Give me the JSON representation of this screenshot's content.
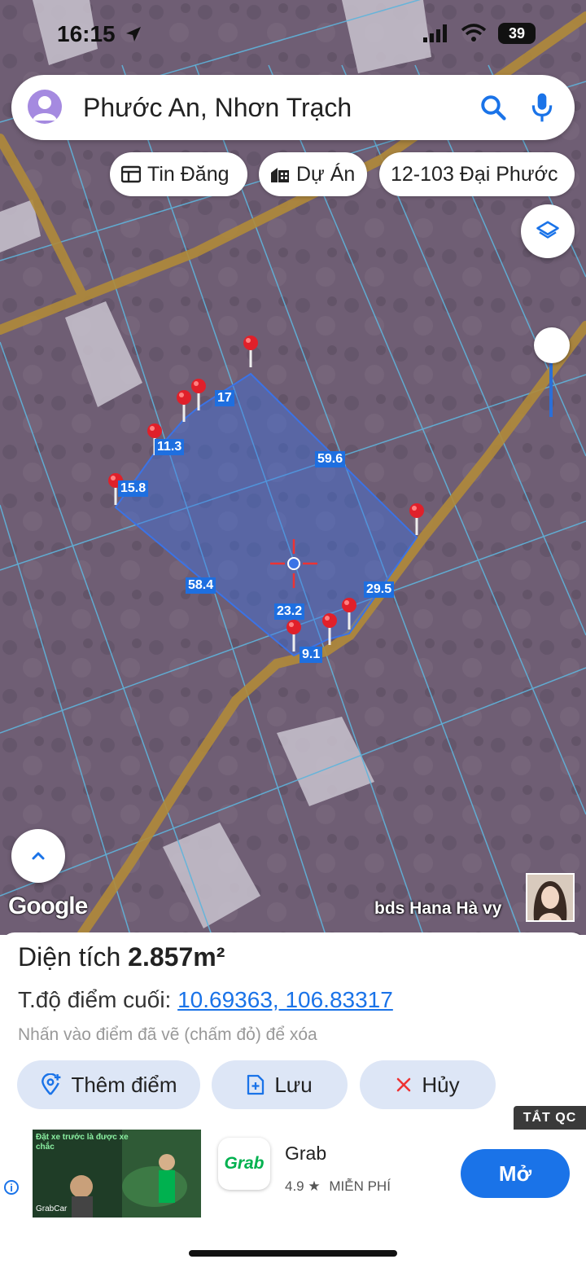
{
  "status_bar": {
    "time": "16:15",
    "battery": "39"
  },
  "search": {
    "query": "Phước An, Nhơn Trạch"
  },
  "chips": [
    {
      "label": "Tin Đăng",
      "icon": "newspaper-icon"
    },
    {
      "label": "Dự Án",
      "icon": "building-icon"
    },
    {
      "label": "12-103 Đại Phước"
    }
  ],
  "map": {
    "segment_labels": [
      "17",
      "11.3",
      "15.8",
      "59.6",
      "58.4",
      "29.5",
      "23.2",
      "9.1"
    ],
    "google_logo": "Google",
    "watermark": "bds Hana Hà vy"
  },
  "sheet": {
    "area_label": "Diện tích",
    "area_value": "2.857m²",
    "coord_label": "T.độ điểm cuối:",
    "coord_value": "10.69363, 106.83317",
    "hint": "Nhấn vào điểm đã vẽ (chấm đỏ) để xóa"
  },
  "actions": {
    "add_point": "Thêm điểm",
    "save": "Lưu",
    "cancel": "Hủy"
  },
  "ad": {
    "close_label": "TẮT QC",
    "app_logo": "Grab",
    "app_name": "Grab",
    "rating": "4.9",
    "price": "MIỄN PHÍ",
    "open_label": "Mở",
    "banner_text": "Đặt xe trước là được xe chắc",
    "banner_brand": "GrabCar"
  },
  "colors": {
    "accent": "#1a73e8",
    "polygon": "#3b73e6",
    "pin": "#e0202a",
    "button_bg": "#dde6f6"
  }
}
